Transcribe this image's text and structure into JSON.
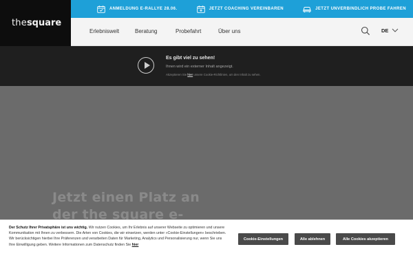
{
  "brand": {
    "logo_thin": "the",
    "logo_bold": "square"
  },
  "promo": {
    "items": [
      {
        "label": "Anmeldung E-Rallye 28.06.",
        "icon": "calendar-icon"
      },
      {
        "label": "Jetzt Coaching vereinbaren",
        "icon": "calendar-add-icon"
      },
      {
        "label": "Jetzt unverbindlich Probe fahren",
        "icon": "car-icon"
      }
    ],
    "accent": "#1ea0d8"
  },
  "nav": {
    "links": [
      "Erlebniswelt",
      "Beratung",
      "Probefahrt",
      "Über uns"
    ],
    "lang": "DE"
  },
  "blocked": {
    "title": "Es gibt viel zu sehen!",
    "subtitle": "Ihnen wird ein externer Inhalt angezeigt.",
    "note_prefix": "Akzeptieren Sie hier",
    "note_link": "hier",
    "note_suffix": "unsere Cookie-Richtlinien, um den Inhalt zu sehen."
  },
  "hero": {
    "line1": "Jetzt einen Platz an",
    "line2": "der the square e-"
  },
  "cookie": {
    "heading": "Der Schutz Ihrer Privatsphäre ist uns wichtig.",
    "body": "Wir nutzen Cookies, um Ihr Erlebnis auf unserer Webseite zu optimieren und unsere Kommunikation mit Ihnen zu verbessern. Die Arten von Cookies, die wir einsetzen, werden unter »Cookie-Einstellungen« beschrieben. Wir berücksichtigen hierbei Ihre Präferenzen und verarbeiten Daten für Marketing, Analytics und Personalisierung nur, wenn Sie uns Ihre Einwilligung geben. Weitere Informationen zum Datenschutz finden Sie",
    "link": "hier",
    "buttons": {
      "settings": "Cookie-Einstellungen",
      "reject": "Alle ablehnen",
      "accept": "Alle Cookies akzeptieren"
    }
  }
}
